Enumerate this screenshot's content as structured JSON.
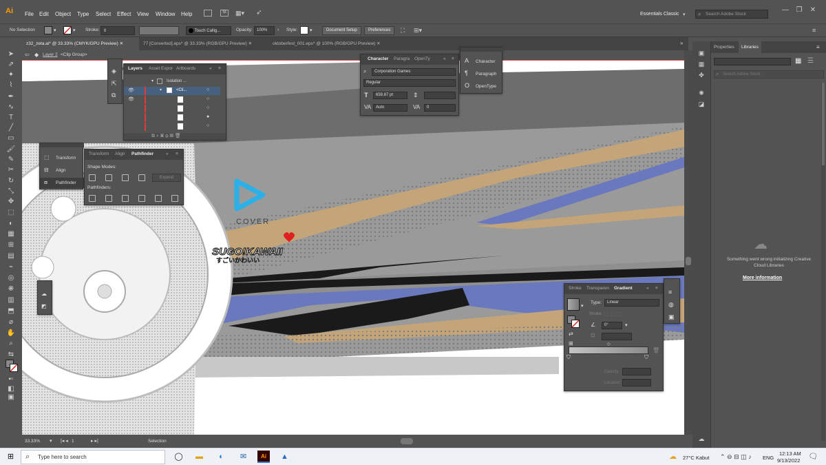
{
  "app": {
    "logo": "Ai"
  },
  "menus": [
    "File",
    "Edit",
    "Object",
    "Type",
    "Select",
    "Effect",
    "View",
    "Window",
    "Help"
  ],
  "menubar_right": {
    "workspace": "Essentials Classic",
    "search_placeholder": "Search Adobe Stock"
  },
  "control": {
    "selection": "No Selection",
    "stroke_label": "Stroke:",
    "brush": "Touch Callig...",
    "opacity_label": "Opacity:",
    "opacity_value": "100%",
    "style_label": "Style:",
    "doc_setup": "Document Setup",
    "preferences": "Preferences"
  },
  "tabs": [
    {
      "label": "z32_zeta.ai* @ 33.33% (CMYK/GPU Preview)"
    },
    {
      "label": "77 [Converted].eps* @ 33.33% (RGB/GPU Preview)"
    },
    {
      "label": "oktoberfest_001.eps* @ 100% (RGB/GPU Preview)"
    }
  ],
  "breadcrumb": {
    "layer": "Layer 2",
    "group": "<Clip Group>"
  },
  "layers_panel": {
    "tabs": [
      "Layers",
      "Asset Expor",
      "Artboards"
    ],
    "rows": [
      {
        "label": "Isolation ..."
      },
      {
        "label": "<Cli..."
      }
    ]
  },
  "transform_dock": {
    "items": [
      "Transform",
      "Align",
      "Pathfinder"
    ]
  },
  "pathfinder_panel": {
    "tabs": [
      "Transform",
      "Align",
      "Pathfinder"
    ],
    "shape_modes": "Shape Modes:",
    "expand": "Expand",
    "pathfinders": "Pathfinders:"
  },
  "character_panel": {
    "tabs": [
      "Character",
      "Paragra",
      "OpenTy"
    ],
    "font": "Corporation Games",
    "style": "Regular",
    "size": "659.87 pt",
    "leading": "Auto",
    "tracking": "0"
  },
  "char_dock": {
    "items": [
      "Character",
      "Paragraph",
      "OpenType"
    ]
  },
  "gradient_panel": {
    "tabs": [
      "Stroke",
      "Transparen",
      "Gradient"
    ],
    "type_label": "Type:",
    "type_value": "Linear",
    "stroke_label": "Stroke:",
    "angle": "0°",
    "opacity_label": "Opacity:",
    "location_label": "Location:"
  },
  "right_panel": {
    "tabs": [
      "Properties",
      "Libraries"
    ],
    "search_placeholder": "Search Adobe Stock",
    "error": "Something went wrong initializing Creative Cloud Libraries",
    "more_info": "More information"
  },
  "artwork": {
    "logo_text": "COVER",
    "brand": "SUGO!KAWAII",
    "brand_jp": "すごいかわいい"
  },
  "status": {
    "zoom": "33.33%",
    "artboard": "1",
    "tool": "Selection"
  },
  "taskbar": {
    "search_placeholder": "Type here to search",
    "weather": "27°C  Kabut",
    "lang": "ENG",
    "time": "12:13 AM",
    "date": "9/13/2022"
  },
  "colors": {
    "ui_bg": "#535353",
    "tan": "#c4a57a",
    "blue": "#6a78bd",
    "dark_stripe": "#1a1a1a",
    "accent_red": "#e02020"
  }
}
